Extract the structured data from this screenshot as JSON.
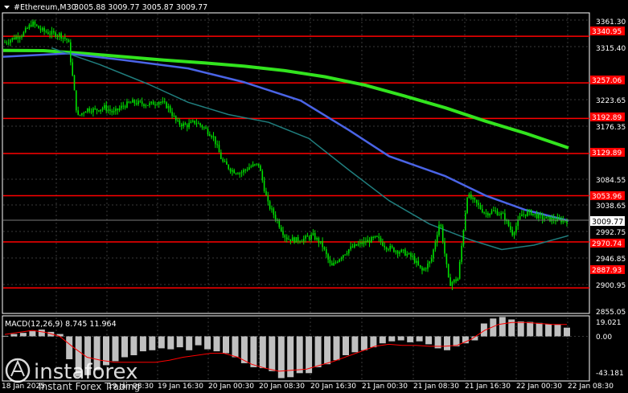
{
  "header": {
    "symbol_label": "#Ethereum,M30",
    "ohlc": "3005.88 3009.77 3005.87 3009.77"
  },
  "macd": {
    "label": "MACD(12,26,9) 8.745 11.964"
  },
  "current_price": "3009.77",
  "price_axis": [
    "3361.30",
    "3315.40",
    "3223.65",
    "3176.35",
    "3084.55",
    "3038.65",
    "2992.75",
    "2946.85",
    "2900.95",
    "2855.05"
  ],
  "macd_axis": [
    "19.021",
    "0.00",
    "-43.181"
  ],
  "time_axis": [
    "18 Jan 2025",
    "19 Jan 08:30",
    "19 Jan 16:30",
    "20 Jan 00:30",
    "20 Jan 08:30",
    "20 Jan 16:30",
    "21 Jan 00:30",
    "21 Jan 08:30",
    "21 Jan 16:30",
    "22 Jan 00:30",
    "22 Jan 08:30"
  ],
  "levels": [
    "3340.95",
    "3257.06",
    "3192.89",
    "3129.89",
    "3053.96",
    "2970.74",
    "2887.93"
  ],
  "watermark": {
    "brand": "instaforex",
    "tagline": "Instant Forex Trading"
  },
  "colors": {
    "background": "#000000",
    "grid": "#3a3a3a",
    "candle": "#00e000",
    "level_line": "#ff0000",
    "ma_green": "#32e41e",
    "ma_blue": "#4a64e6",
    "ma_teal": "#207e7e",
    "macd_hist": "#c0c0c0",
    "macd_signal": "#ff0000"
  },
  "chart_data": {
    "type": "candlestick",
    "symbol": "#Ethereum",
    "timeframe": "M30",
    "x": [
      "18 Jan 2025",
      "19 Jan 08:30",
      "19 Jan 16:30",
      "20 Jan 00:30",
      "20 Jan 08:30",
      "20 Jan 16:30",
      "21 Jan 00:30",
      "21 Jan 08:30",
      "21 Jan 16:30",
      "22 Jan 00:30",
      "22 Jan 08:30"
    ],
    "ylim": [
      2842,
      3383
    ],
    "price_close_path": [
      3330,
      3338,
      3345,
      3365,
      3352,
      3346,
      3344,
      3333,
      3195,
      3210,
      3208,
      3213,
      3203,
      3215,
      3222,
      3220,
      3218,
      3224,
      3214,
      3185,
      3180,
      3187,
      3176,
      3160,
      3115,
      3100,
      3095,
      3106,
      3110,
      3040,
      3010,
      2978,
      2974,
      2976,
      2982,
      2965,
      2925,
      2944,
      2958,
      2966,
      2972,
      2978,
      2963,
      2956,
      2952,
      2942,
      2918,
      2936,
      3010,
      2895,
      2905,
      3055,
      3040,
      3022,
      3026,
      3018,
      2986,
      3020,
      3024,
      3015,
      3012,
      3010,
      3009.77
    ],
    "ma_green": [
      [
        0,
        3315.4
      ],
      [
        50,
        3315
      ],
      [
        100,
        3310
      ],
      [
        150,
        3304
      ],
      [
        200,
        3298
      ],
      [
        250,
        3293
      ],
      [
        300,
        3287
      ],
      [
        350,
        3279
      ],
      [
        400,
        3268
      ],
      [
        450,
        3253
      ],
      [
        500,
        3233
      ],
      [
        550,
        3212
      ],
      [
        600,
        3188
      ],
      [
        650,
        3166
      ],
      [
        703,
        3140
      ]
    ],
    "ma_blue": [
      [
        0,
        3304
      ],
      [
        80,
        3310
      ],
      [
        150,
        3298
      ],
      [
        230,
        3283
      ],
      [
        300,
        3258
      ],
      [
        370,
        3225
      ],
      [
        430,
        3172
      ],
      [
        480,
        3125
      ],
      [
        550,
        3089
      ],
      [
        600,
        3054
      ],
      [
        650,
        3028
      ],
      [
        703,
        3009
      ]
    ],
    "ma_teal": [
      [
        60,
        3320
      ],
      [
        120,
        3290
      ],
      [
        180,
        3255
      ],
      [
        230,
        3222
      ],
      [
        280,
        3200
      ],
      [
        330,
        3186
      ],
      [
        380,
        3157
      ],
      [
        430,
        3100
      ],
      [
        480,
        3045
      ],
      [
        530,
        3003
      ],
      [
        580,
        2975
      ],
      [
        620,
        2957
      ],
      [
        660,
        2965
      ],
      [
        703,
        2982
      ]
    ],
    "levels": [
      3340.95,
      3257.06,
      3192.89,
      3129.89,
      3053.96,
      2970.74,
      2887.93
    ],
    "macd": {
      "ylim": [
        -43.181,
        19.021
      ],
      "histogram": [
        0.5,
        2.4,
        3.5,
        5.2,
        6.8,
        4.6,
        2.4,
        -23,
        -40.5,
        -39,
        -34,
        -29,
        -25,
        -21,
        -19,
        -15,
        -14,
        -12,
        -13,
        -11,
        -14,
        -9,
        -13,
        -15,
        -17,
        -21,
        -27,
        -31,
        -32,
        -35,
        -42,
        -41,
        -37,
        -37,
        -31,
        -28,
        -24,
        -19,
        -16,
        -14,
        -11,
        -7,
        -5,
        -4,
        -6,
        -5,
        -8,
        -12,
        -14,
        -10,
        -7,
        -4,
        13,
        18,
        19.5,
        17,
        15,
        14.5,
        13.5,
        12.5,
        11.964,
        8.745
      ],
      "signal": [
        2,
        4,
        6,
        4,
        0,
        -11,
        -21,
        -24,
        -26,
        -26,
        -26,
        -26,
        -24,
        -21,
        -19,
        -17,
        -17,
        -21,
        -28,
        -32,
        -35,
        -34,
        -33,
        -29,
        -25,
        -20,
        -15,
        -10,
        -8,
        -9,
        -9,
        -10,
        -10,
        -9,
        -3,
        6,
        12,
        14,
        14,
        13,
        12,
        11.964
      ]
    }
  }
}
